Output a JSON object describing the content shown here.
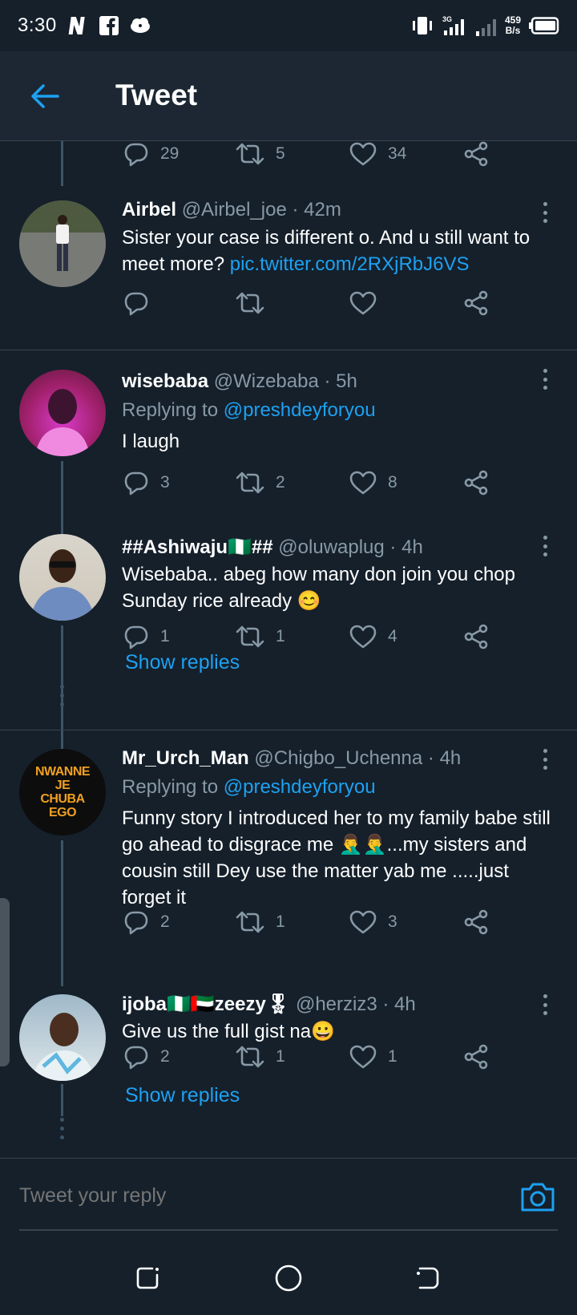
{
  "status_bar": {
    "time": "3:30",
    "net_speed_value": "459",
    "net_speed_unit": "B/s",
    "network_label": "3G"
  },
  "header": {
    "title": "Tweet"
  },
  "prev_actions": {
    "replies": "29",
    "retweets": "5",
    "likes": "34"
  },
  "tweets": [
    {
      "name": "Airbel",
      "handle": "@Airbel_joe",
      "time": "42m",
      "text": "Sister your case is different o. And u still want to meet more? ",
      "link": "pic.twitter.com/2RXjRbJ6VS",
      "replies": "",
      "retweets": "",
      "likes": ""
    },
    {
      "name": "wisebaba",
      "handle": "@Wizebaba",
      "time": "5h",
      "replying_prefix": "Replying to ",
      "replying_to": "@preshdeyforyou",
      "text": "I laugh",
      "replies": "3",
      "retweets": "2",
      "likes": "8"
    },
    {
      "name": "##Ashiwaju🇳🇬##",
      "handle": "@oluwaplug",
      "time": "4h",
      "text": "Wisebaba.. abeg how many don join you chop Sunday rice already 😊",
      "replies": "1",
      "retweets": "1",
      "likes": "4",
      "show_replies": "Show replies"
    },
    {
      "name": "Mr_Urch_Man",
      "handle": "@Chigbo_Uchenna",
      "time": "4h",
      "replying_prefix": "Replying to ",
      "replying_to": "@preshdeyforyou",
      "text": "Funny story I introduced her to my family babe still go ahead to disgrace me 🤦‍♂️🤦‍♂️...my sisters and cousin still Dey use the matter yab me .....just forget it",
      "replies": "2",
      "retweets": "1",
      "likes": "3",
      "avatar_text": [
        "NWANNE",
        "JE",
        "CHUBA",
        "EGO"
      ]
    },
    {
      "name": "ijoba🇳🇬🇦🇪zeezy🎖",
      "handle": "@herziz3",
      "time": "4h",
      "text": "Give us the full gist na😀",
      "replies": "2",
      "retweets": "1",
      "likes": "1",
      "show_replies": "Show replies"
    }
  ],
  "reply_bar": {
    "placeholder": "Tweet your reply"
  },
  "colors": {
    "background": "#15202b",
    "header": "#1c2733",
    "accent": "#1da1f2",
    "muted": "#8899a6",
    "divider": "#38444d"
  }
}
